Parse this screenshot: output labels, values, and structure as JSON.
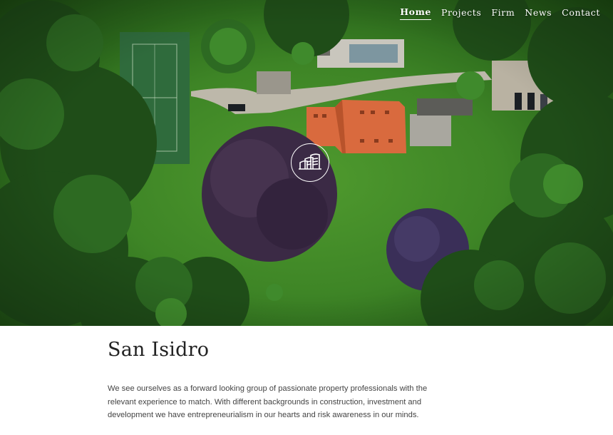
{
  "nav": {
    "items": [
      {
        "label": "Home",
        "active": true
      },
      {
        "label": "Projects",
        "active": false
      },
      {
        "label": "Firm",
        "active": false
      },
      {
        "label": "News",
        "active": false
      },
      {
        "label": "Contact",
        "active": false
      }
    ]
  },
  "hero": {
    "logo_icon": "buildings-logo-icon",
    "accent_color": "#ffffff"
  },
  "page": {
    "title": "San Isidro",
    "intro": "We see ourselves as a forward looking group of passionate property professionals with the relevant experience to match. With different backgrounds in construction, investment and development we have entrepreneurialism in our hearts and risk awareness in our minds."
  }
}
